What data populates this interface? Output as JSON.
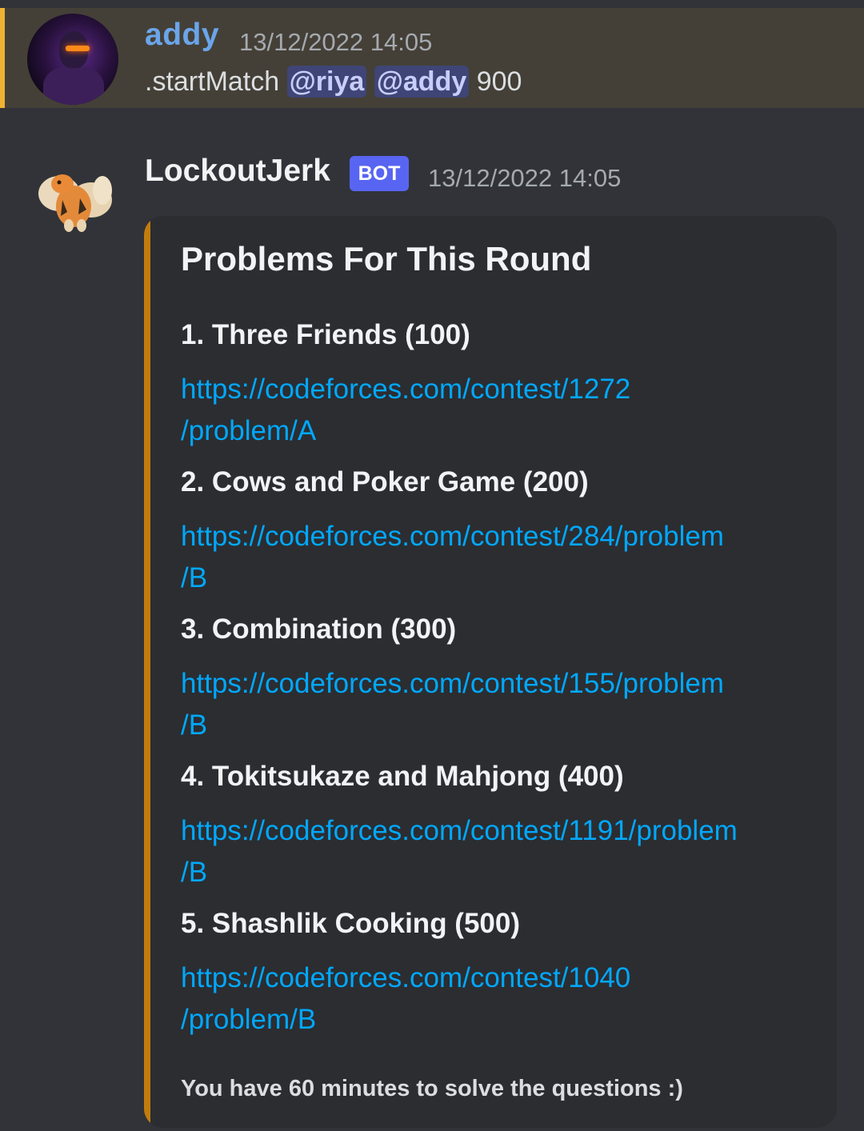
{
  "user_message": {
    "username": "addy",
    "timestamp": "13/12/2022 14:05",
    "command": ".startMatch",
    "mentions": [
      "@riya",
      "@addy"
    ],
    "argument": "900"
  },
  "bot_message": {
    "botname": "LockoutJerk",
    "bot_tag": "BOT",
    "timestamp": "13/12/2022 14:05",
    "embed": {
      "title": "Problems For This Round",
      "problems": [
        {
          "title": "1. Three Friends (100)",
          "link_line1": "https://codeforces.com/contest/1272",
          "link_line2": "/problem/A"
        },
        {
          "title": "2. Cows and Poker Game (200)",
          "link_line1": "https://codeforces.com/contest/284/problem",
          "link_line2": "/B"
        },
        {
          "title": "3. Combination (300)",
          "link_line1": "https://codeforces.com/contest/155/problem",
          "link_line2": "/B"
        },
        {
          "title": "4. Tokitsukaze and Mahjong (400)",
          "link_line1": "https://codeforces.com/contest/1191/problem",
          "link_line2": "/B"
        },
        {
          "title": "5. Shashlik Cooking (500)",
          "link_line1": "https://codeforces.com/contest/1040",
          "link_line2": "/problem/B"
        }
      ],
      "footer": "You have 60 minutes to solve the questions :)"
    }
  },
  "colors": {
    "background": "#313338",
    "highlight": "#444037",
    "mention_bar": "#f0b232",
    "username": "#6ba5ea",
    "link": "#00a8fc",
    "embed_bar": "#c27c0e",
    "bot_tag": "#5865f2"
  }
}
